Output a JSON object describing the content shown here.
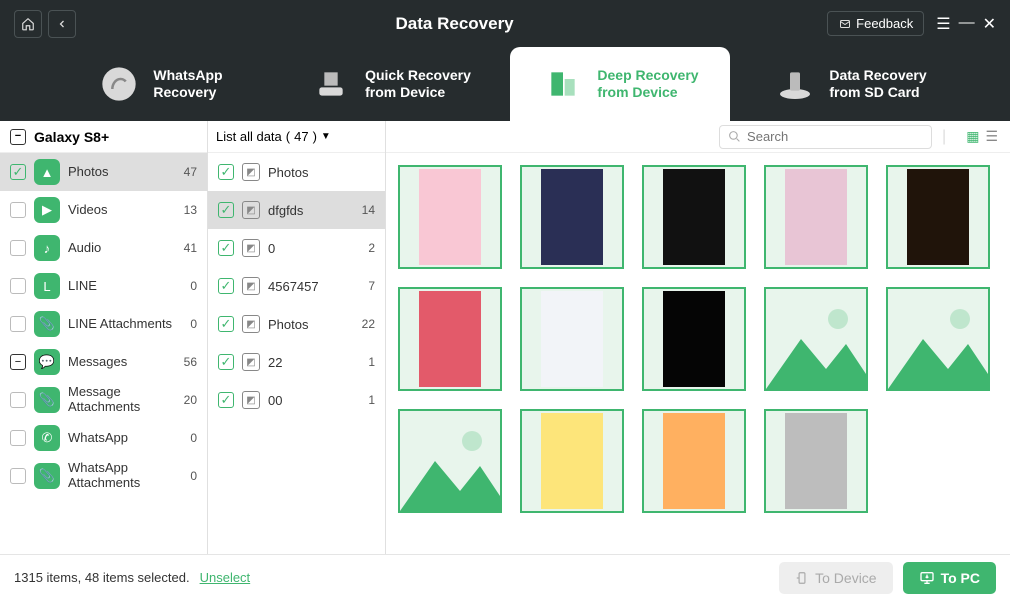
{
  "header": {
    "title": "Data Recovery",
    "feedback": "Feedback"
  },
  "tabs": [
    {
      "line1": "WhatsApp",
      "line2": "Recovery"
    },
    {
      "line1": "Quick Recovery",
      "line2": "from Device"
    },
    {
      "line1": "Deep Recovery",
      "line2": "from Device",
      "active": true
    },
    {
      "line1": "Data Recovery",
      "line2": "from SD Card"
    }
  ],
  "device": {
    "name": "Galaxy S8+"
  },
  "categories": [
    {
      "label": "Photos",
      "count": 47,
      "checked": true,
      "selected": true,
      "collapse": null
    },
    {
      "label": "Videos",
      "count": 13,
      "checked": false
    },
    {
      "label": "Audio",
      "count": 41,
      "checked": false
    },
    {
      "label": "LINE",
      "count": 0,
      "checked": false
    },
    {
      "label": "LINE Attachments",
      "count": 0,
      "checked": false
    },
    {
      "label": "Messages",
      "count": 56,
      "checked": false,
      "collapse": true
    },
    {
      "label": "Message Attachments",
      "count": 20,
      "checked": false
    },
    {
      "label": "WhatsApp",
      "count": 0,
      "checked": false
    },
    {
      "label": "WhatsApp Attachments",
      "count": 0,
      "checked": false
    }
  ],
  "filter": {
    "label": "List all data",
    "count": 47
  },
  "folders": [
    {
      "label": "Photos",
      "count": "",
      "checked": true
    },
    {
      "label": "dfgfds",
      "count": 14,
      "checked": true,
      "selected": true
    },
    {
      "label": "0",
      "count": 2,
      "checked": true
    },
    {
      "label": "4567457",
      "count": 7,
      "checked": true
    },
    {
      "label": "Photos",
      "count": 22,
      "checked": true
    },
    {
      "label": "22",
      "count": 1,
      "checked": true
    },
    {
      "label": "00",
      "count": 1,
      "checked": true
    }
  ],
  "search": {
    "placeholder": "Search"
  },
  "thumbnails": {
    "count": 14
  },
  "footer": {
    "status_prefix": "1315 items, 48 items selected.",
    "unselect": "Unselect",
    "to_device": "To Device",
    "to_pc": "To PC"
  },
  "colors": {
    "accent": "#3fb66f"
  }
}
